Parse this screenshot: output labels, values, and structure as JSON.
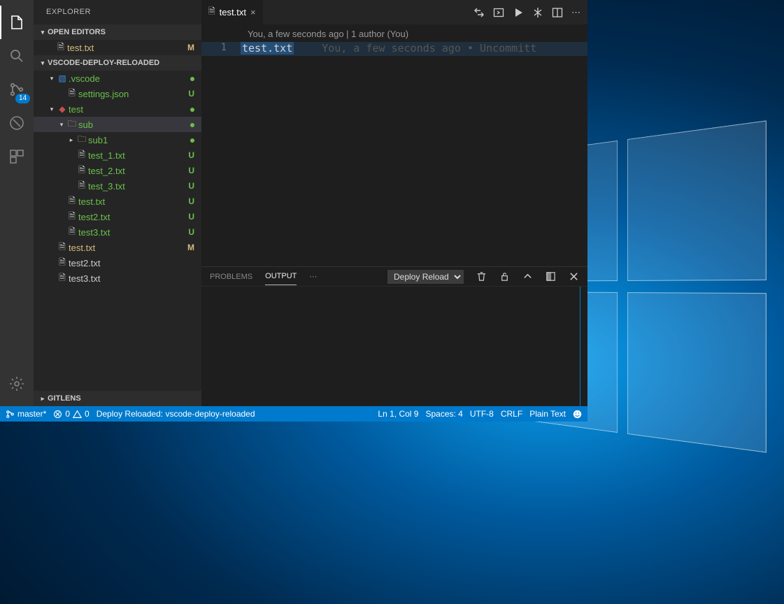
{
  "activity": {
    "scm_badge": "14"
  },
  "sidebar": {
    "title": "EXPLORER",
    "open_editors_label": "OPEN EDITORS",
    "open_editor": {
      "name": "test.txt",
      "state": "M"
    },
    "workspace_label": "VSCODE-DEPLOY-RELOADED",
    "gitlens_label": "GITLENS",
    "tree": [
      {
        "indent": 1,
        "twisty": "▾",
        "icon": "folder-blue",
        "label": ".vscode",
        "state": "dot",
        "color": "green"
      },
      {
        "indent": 2,
        "twisty": "",
        "icon": "file",
        "label": "settings.json",
        "state": "U",
        "color": "green"
      },
      {
        "indent": 1,
        "twisty": "▾",
        "icon": "folder-red",
        "label": "test",
        "state": "dot",
        "color": "green"
      },
      {
        "indent": 2,
        "twisty": "▾",
        "icon": "folder-y",
        "label": "sub",
        "state": "dot",
        "color": "green",
        "selected": true
      },
      {
        "indent": 3,
        "twisty": "▸",
        "icon": "folder-y",
        "label": "sub1",
        "state": "dot",
        "color": "green"
      },
      {
        "indent": 3,
        "twisty": "",
        "icon": "file",
        "label": "test_1.txt",
        "state": "U",
        "color": "green"
      },
      {
        "indent": 3,
        "twisty": "",
        "icon": "file",
        "label": "test_2.txt",
        "state": "U",
        "color": "green"
      },
      {
        "indent": 3,
        "twisty": "",
        "icon": "file",
        "label": "test_3.txt",
        "state": "U",
        "color": "green"
      },
      {
        "indent": 2,
        "twisty": "",
        "icon": "file",
        "label": "test.txt",
        "state": "U",
        "color": "green"
      },
      {
        "indent": 2,
        "twisty": "",
        "icon": "file",
        "label": "test2.txt",
        "state": "U",
        "color": "green"
      },
      {
        "indent": 2,
        "twisty": "",
        "icon": "file",
        "label": "test3.txt",
        "state": "U",
        "color": "green"
      },
      {
        "indent": 1,
        "twisty": "",
        "icon": "file",
        "label": "test.txt",
        "state": "M",
        "color": "mod"
      },
      {
        "indent": 1,
        "twisty": "",
        "icon": "file",
        "label": "test2.txt",
        "state": "",
        "color": "white"
      },
      {
        "indent": 1,
        "twisty": "",
        "icon": "file",
        "label": "test3.txt",
        "state": "",
        "color": "white"
      }
    ]
  },
  "editor": {
    "tab_name": "test.txt",
    "lens": "You, a few seconds ago | 1 author (You)",
    "line_number": "1",
    "content": "test.txt",
    "blame": "You, a few seconds ago • Uncommitt"
  },
  "panel": {
    "tabs": {
      "problems": "PROBLEMS",
      "output": "OUTPUT"
    },
    "select": "Deploy Reload"
  },
  "status": {
    "branch": "master*",
    "errors": "0",
    "warnings": "0",
    "deploy": "Deploy Reloaded: vscode-deploy-reloaded",
    "lncol": "Ln 1, Col 9",
    "spaces": "Spaces: 4",
    "encoding": "UTF-8",
    "eol": "CRLF",
    "lang": "Plain Text"
  }
}
